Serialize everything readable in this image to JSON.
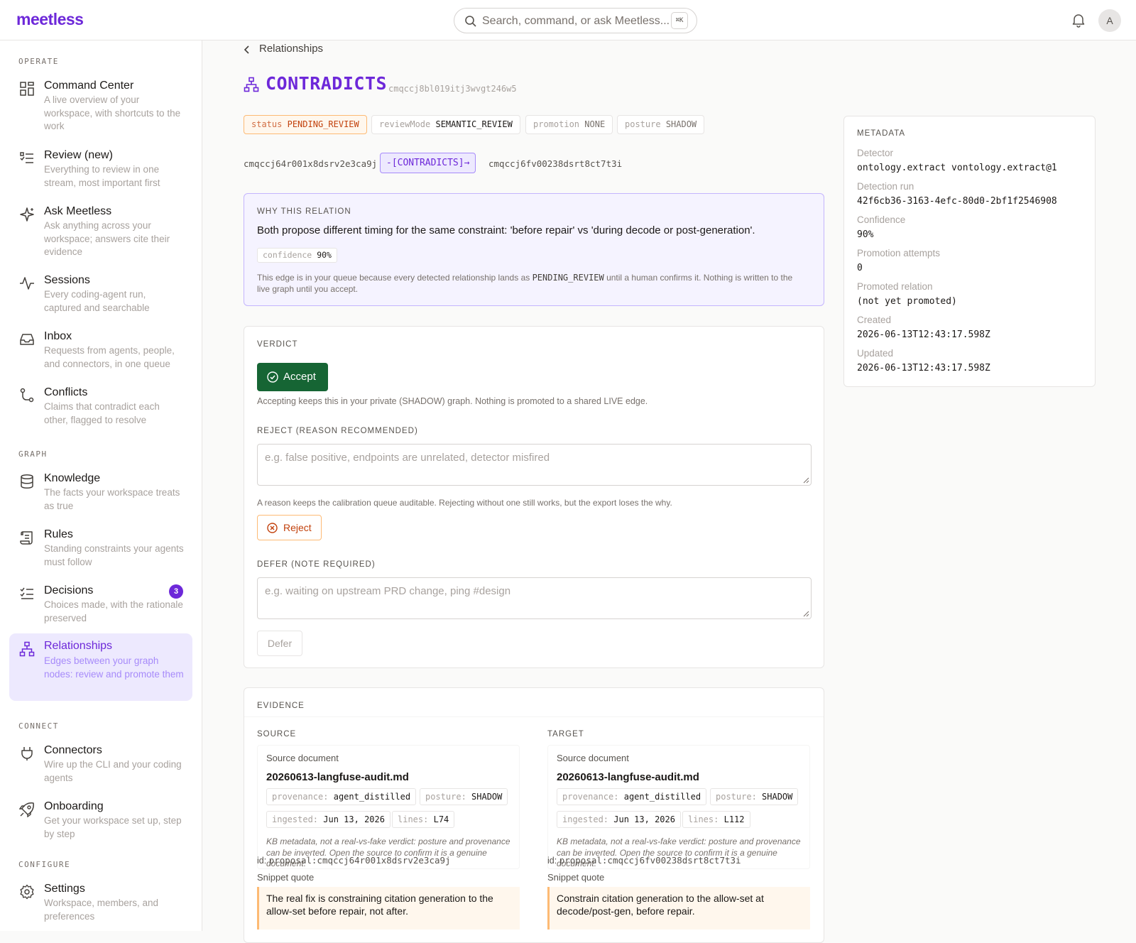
{
  "app": {
    "logo": "meetless"
  },
  "search": {
    "placeholder": "Search, command, or ask Meetless...",
    "shortcut": "⌘K"
  },
  "user": {
    "avatar_initial": "A"
  },
  "sidebar": {
    "sections": {
      "operate": "OPERATE",
      "graph": "GRAPH",
      "connect": "CONNECT",
      "configure": "CONFIGURE"
    },
    "items": [
      {
        "title": "Command Center",
        "desc": "A live overview of your workspace, with shortcuts to the work",
        "icon": "dashboard-icon"
      },
      {
        "title": "Review (new)",
        "desc": "Everything to review in one stream, most important first",
        "icon": "list-icon"
      },
      {
        "title": "Ask Meetless",
        "desc": "Ask anything across your workspace; answers cite their evidence",
        "icon": "sparkle-icon"
      },
      {
        "title": "Sessions",
        "desc": "Every coding-agent run, captured and searchable",
        "icon": "activity-icon"
      },
      {
        "title": "Inbox",
        "desc": "Requests from agents, people, and connectors, in one queue",
        "icon": "inbox-icon"
      },
      {
        "title": "Conflicts",
        "desc": "Claims that contradict each other, flagged to resolve",
        "icon": "branch-icon"
      },
      {
        "title": "Knowledge",
        "desc": "The facts your workspace treats as true",
        "icon": "database-icon"
      },
      {
        "title": "Rules",
        "desc": "Standing constraints your agents must follow",
        "icon": "scroll-icon"
      },
      {
        "title": "Decisions",
        "desc": "Choices made, with the rationale preserved",
        "icon": "checklist-icon",
        "badge": "3"
      },
      {
        "title": "Relationships",
        "desc": "Edges between your graph nodes: review and promote them",
        "icon": "hierarchy-icon"
      },
      {
        "title": "Connectors",
        "desc": "Wire up the CLI and your coding agents",
        "icon": "plug-icon"
      },
      {
        "title": "Onboarding",
        "desc": "Get your workspace set up, step by step",
        "icon": "rocket-icon"
      },
      {
        "title": "Settings",
        "desc": "Workspace, members, and preferences",
        "icon": "gear-icon"
      }
    ]
  },
  "breadcrumb": {
    "label": "Relationships"
  },
  "relation": {
    "type": "CONTRADICTS",
    "id": "cmqccj8bl019itj3wvgt246w5",
    "chips": {
      "status": {
        "k": "status",
        "v": "PENDING_REVIEW"
      },
      "reviewMode": {
        "k": "reviewMode",
        "v": "SEMANTIC_REVIEW"
      },
      "promotion": {
        "k": "promotion",
        "v": "NONE"
      },
      "posture": {
        "k": "posture",
        "v": "SHADOW"
      }
    },
    "source_id": "cmqccj64r001x8dsrv2e3ca9j",
    "edge_label": "-[CONTRADICTS]→",
    "target_id": "cmqccj6fv00238dsrt8ct7t3i"
  },
  "why": {
    "label": "WHY THIS RELATION",
    "text": "Both propose different timing for the same constraint: 'before repair' vs 'during decode or post-generation'.",
    "confidence_k": "confidence",
    "confidence_v": "90%",
    "note_a": "This edge is in your queue because every detected relationship lands as ",
    "note_code": "PENDING_REVIEW",
    "note_b": " until a human confirms it. Nothing is written to the live graph until you accept."
  },
  "verdict": {
    "label": "VERDICT",
    "accept_label": "Accept",
    "accept_hint": "Accepting keeps this in your private (SHADOW) graph. Nothing is promoted to a shared LIVE edge.",
    "reject_label": "REJECT (REASON RECOMMENDED)",
    "reject_placeholder": "e.g. false positive, endpoints are unrelated, detector misfired",
    "reject_hint": "A reason keeps the calibration queue auditable. Rejecting without one still works, but the export loses the why.",
    "reject_button": "Reject",
    "defer_label": "DEFER (NOTE REQUIRED)",
    "defer_placeholder": "e.g. waiting on upstream PRD change, ping #design",
    "defer_button": "Defer"
  },
  "evidence": {
    "label": "EVIDENCE",
    "source_doc_label": "Source document",
    "id_prefix": "id:",
    "snippet_label": "Snippet quote",
    "kb_note": "KB metadata, not a real-vs-fake verdict: posture and provenance can be inverted. Open the source to confirm it is a genuine document.",
    "source": {
      "heading": "SOURCE",
      "file": "20260613-langfuse-audit.md",
      "provenance_k": "provenance:",
      "provenance_v": "agent_distilled",
      "posture_k": "posture:",
      "posture_v": "SHADOW",
      "ingested_k": "ingested:",
      "ingested_v": "Jun 13, 2026",
      "lines_k": "lines:",
      "lines_v": "L74",
      "proposal_id": "proposal:cmqccj64r001x8dsrv2e3ca9j",
      "quote": "The real fix is constraining citation generation to the allow-set before repair, not after."
    },
    "target": {
      "heading": "TARGET",
      "file": "20260613-langfuse-audit.md",
      "provenance_k": "provenance:",
      "provenance_v": "agent_distilled",
      "posture_k": "posture:",
      "posture_v": "SHADOW",
      "ingested_k": "ingested:",
      "ingested_v": "Jun 13, 2026",
      "lines_k": "lines:",
      "lines_v": "L112",
      "proposal_id": "proposal:cmqccj6fv00238dsrt8ct7t3i",
      "quote": "Constrain citation generation to the allow-set at decode/post-gen, before repair."
    }
  },
  "metadata": {
    "label": "METADATA",
    "rows": [
      {
        "k": "Detector",
        "v": "ontology.extract vontology.extract@1"
      },
      {
        "k": "Detection run",
        "v": "42f6cb36-3163-4efc-80d0-2bf1f2546908"
      },
      {
        "k": "Confidence",
        "v": "90%"
      },
      {
        "k": "Promotion attempts",
        "v": "0"
      },
      {
        "k": "Promoted relation",
        "v": "(not yet promoted)"
      },
      {
        "k": "Created",
        "v": "2026-06-13T12:43:17.598Z"
      },
      {
        "k": "Updated",
        "v": "2026-06-13T12:43:17.598Z"
      }
    ]
  },
  "colors": {
    "brand": "#6d28d9",
    "accept": "#166534",
    "warning": "#c2410c"
  }
}
